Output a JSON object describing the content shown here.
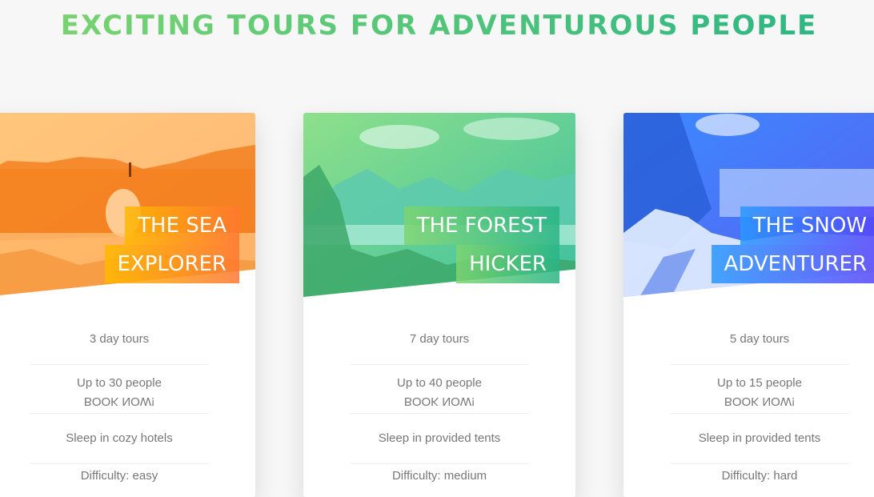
{
  "heading": "EXCITING TOURS FOR ADVENTUROUS PEOPLE",
  "cards": [
    {
      "title_line1": "THE SEA",
      "title_line2": "EXPLORER",
      "details": [
        "3 day tours",
        "Up to 30 people",
        "BOOK NOW!",
        "Sleep in cozy hotels",
        "Difficulty: easy"
      ],
      "accent": "#ff9a3c"
    },
    {
      "title_line1": "THE FOREST",
      "title_line2": "HICKER",
      "details": [
        "7 day tours",
        "Up to 40 people",
        "BOOK NOW!",
        "Sleep in provided tents",
        "Difficulty: medium"
      ],
      "accent": "#3ebf7a"
    },
    {
      "title_line1": "THE SNOW",
      "title_line2": "ADVENTURER",
      "details": [
        "5 day tours",
        "Up to 15 people",
        "BOOK NOW!",
        "Sleep in provided tents",
        "Difficulty: hard"
      ],
      "accent": "#3d6ff2"
    }
  ]
}
